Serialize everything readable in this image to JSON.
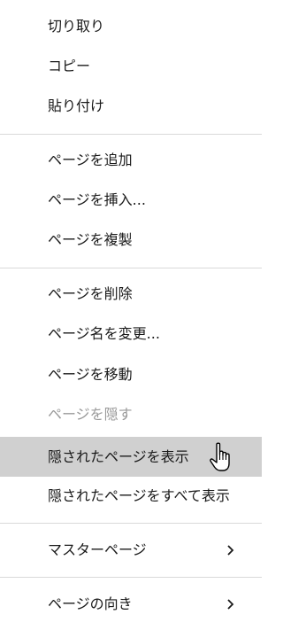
{
  "menu": {
    "items": [
      {
        "label": "切り取り"
      },
      {
        "label": "コピー"
      },
      {
        "label": "貼り付け"
      },
      {
        "label": "ページを追加"
      },
      {
        "label": "ページを挿入..."
      },
      {
        "label": "ページを複製"
      },
      {
        "label": "ページを削除"
      },
      {
        "label": "ページ名を変更..."
      },
      {
        "label": "ページを移動"
      },
      {
        "label": "ページを隠す"
      },
      {
        "label": "隠されたページを表示"
      },
      {
        "label": "隠されたページをすべて表示"
      },
      {
        "label": "マスターページ"
      },
      {
        "label": "ページの向き"
      }
    ]
  },
  "icons": {
    "submenu_arrow": "chevron-right-icon",
    "cursor": "hand-pointer-cursor-icon"
  },
  "colors": {
    "hover_bg": "#d0d0d0",
    "disabled_text": "#9a9a9a",
    "separator": "#d9d9d9"
  }
}
